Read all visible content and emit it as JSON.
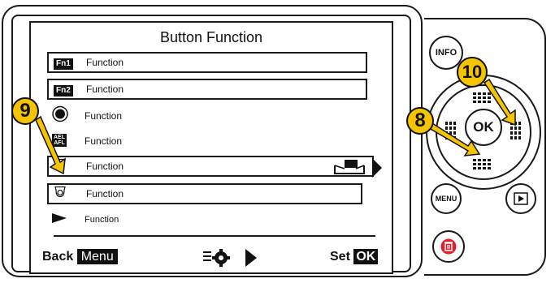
{
  "screen": {
    "title": "Button Function",
    "rows": [
      {
        "icon": "fn1-badge",
        "badge": "Fn1",
        "label": "Function",
        "boxed": true
      },
      {
        "icon": "fn2-badge",
        "badge": "Fn2",
        "label": "Function",
        "boxed": true
      },
      {
        "icon": "record-button-icon",
        "label": "Function",
        "boxed": false
      },
      {
        "icon": "ael-afl-badge",
        "badge_top": "AEL",
        "badge_bottom": "AFL",
        "label": "Function",
        "boxed": false
      },
      {
        "icon": "shutter-button-icon",
        "label": "Function",
        "boxed": true,
        "selected": true
      },
      {
        "icon": "shutter-button-icon",
        "label": "Function",
        "boxed": true
      },
      {
        "icon": "play-arrow-icon",
        "label": "Function",
        "boxed": false
      }
    ],
    "bottom": {
      "back_text": "Back",
      "back_key": "Menu",
      "set_text": "Set",
      "set_key": "OK"
    }
  },
  "controls": {
    "info_label": "INFO",
    "ok_label": "OK",
    "menu_label": "MENU"
  },
  "callouts": {
    "c8": "8",
    "c9": "9",
    "c10": "10"
  },
  "colors": {
    "callout_fill": "#f5c400",
    "trash_red": "#e0202a",
    "outline": "#1a1a1a"
  }
}
